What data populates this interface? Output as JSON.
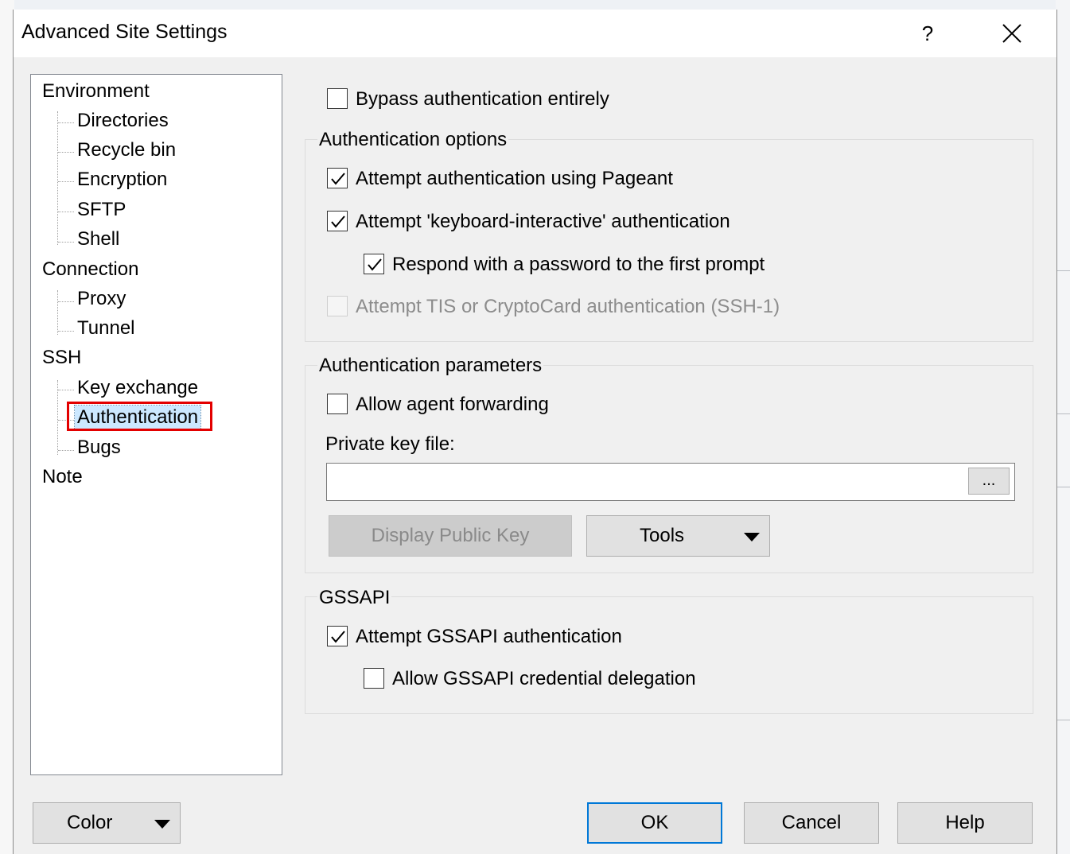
{
  "dialog": {
    "title": "Advanced Site Settings",
    "help_label": "?",
    "close_label": "✕"
  },
  "tree": {
    "items": [
      {
        "label": "Environment",
        "level": 0
      },
      {
        "label": "Directories",
        "level": 1
      },
      {
        "label": "Recycle bin",
        "level": 1
      },
      {
        "label": "Encryption",
        "level": 1
      },
      {
        "label": "SFTP",
        "level": 1
      },
      {
        "label": "Shell",
        "level": 1
      },
      {
        "label": "Connection",
        "level": 0
      },
      {
        "label": "Proxy",
        "level": 1
      },
      {
        "label": "Tunnel",
        "level": 1
      },
      {
        "label": "SSH",
        "level": 0
      },
      {
        "label": "Key exchange",
        "level": 1
      },
      {
        "label": "Authentication",
        "level": 1,
        "selected": true
      },
      {
        "label": "Bugs",
        "level": 1
      },
      {
        "label": "Note",
        "level": 0
      }
    ]
  },
  "auth": {
    "bypass": {
      "label": "Bypass authentication entirely",
      "checked": false
    },
    "options_title": "Authentication options",
    "pageant": {
      "label": "Attempt authentication using Pageant",
      "checked": true
    },
    "keyboard_interactive": {
      "label": "Attempt 'keyboard-interactive' authentication",
      "checked": true
    },
    "respond_password": {
      "label": "Respond with a password to the first prompt",
      "checked": true
    },
    "tis": {
      "label": "Attempt TIS or CryptoCard authentication (SSH-1)",
      "checked": false,
      "disabled": true
    },
    "params_title": "Authentication parameters",
    "agent_forwarding": {
      "label": "Allow agent forwarding",
      "checked": false
    },
    "private_key_label": "Private key file:",
    "private_key_value": "",
    "browse_label": "...",
    "display_public_key": "Display Public Key",
    "tools_label": "Tools",
    "gssapi_title": "GSSAPI",
    "gssapi_attempt": {
      "label": "Attempt GSSAPI authentication",
      "checked": true
    },
    "gssapi_delegation": {
      "label": "Allow GSSAPI credential delegation",
      "checked": false
    }
  },
  "footer": {
    "color_label": "Color",
    "ok_label": "OK",
    "cancel_label": "Cancel",
    "help_label": "Help"
  },
  "colors": {
    "selection_highlight": "#cce8ff",
    "annotation_box": "#e30000",
    "default_button_border": "#0078d7"
  }
}
